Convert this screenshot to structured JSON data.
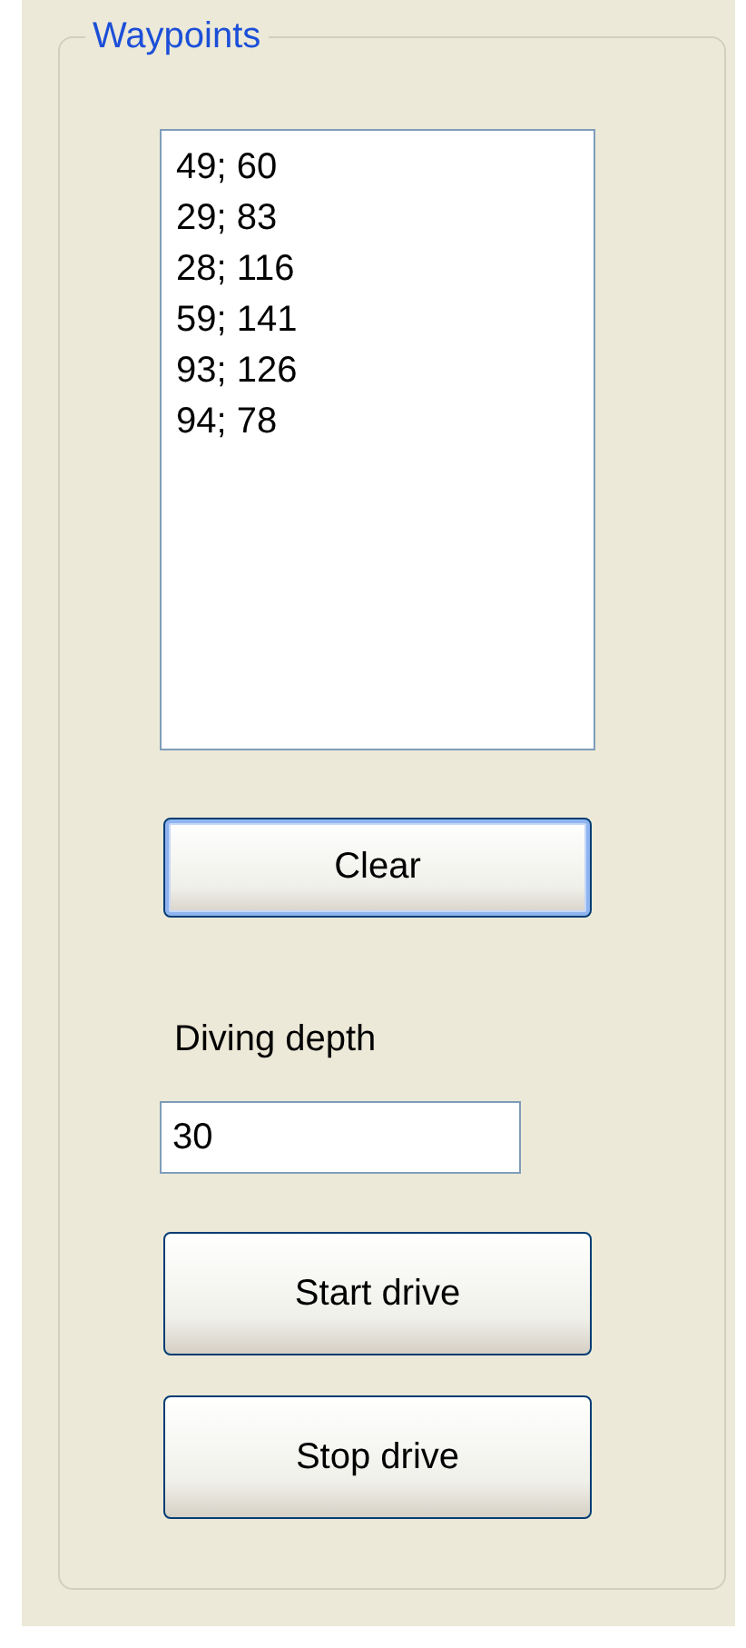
{
  "group": {
    "title": "Waypoints"
  },
  "waypoints": [
    "49; 60",
    "29; 83",
    "28; 116",
    "59; 141",
    "93; 126",
    "94; 78"
  ],
  "clear_button": {
    "label": "Clear",
    "focused": true
  },
  "depth": {
    "label": "Diving depth",
    "value": "30"
  },
  "buttons": [
    {
      "label": "Start drive",
      "focused": false
    },
    {
      "label": "Stop drive",
      "focused": false
    }
  ]
}
